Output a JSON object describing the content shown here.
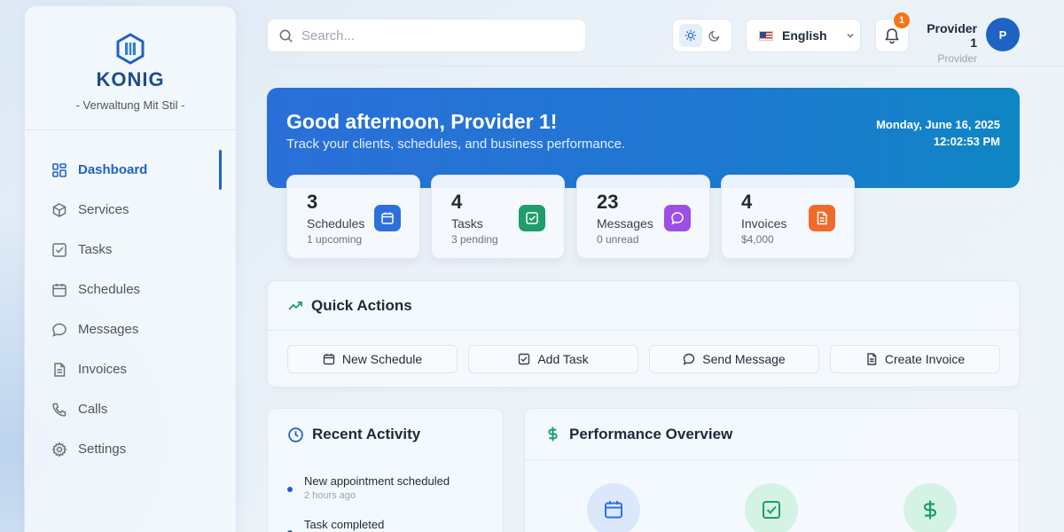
{
  "brand": {
    "name": "KONIG",
    "tagline": "- Verwaltung Mit Stil -"
  },
  "sidebar": {
    "items": [
      {
        "label": "Dashboard",
        "icon": "dashboard-icon",
        "active": true
      },
      {
        "label": "Services",
        "icon": "cube-icon"
      },
      {
        "label": "Tasks",
        "icon": "checkbox-icon"
      },
      {
        "label": "Schedules",
        "icon": "calendar-icon"
      },
      {
        "label": "Messages",
        "icon": "message-icon"
      },
      {
        "label": "Invoices",
        "icon": "document-icon"
      },
      {
        "label": "Calls",
        "icon": "phone-icon"
      },
      {
        "label": "Settings",
        "icon": "gear-icon"
      }
    ]
  },
  "topbar": {
    "search_placeholder": "Search...",
    "language": "English",
    "notifications_count": "1",
    "user_name": "Provider 1",
    "user_role": "Provider",
    "avatar_initial": "P"
  },
  "hero": {
    "greeting": "Good afternoon, Provider 1!",
    "subtitle": "Track your clients, schedules, and business performance.",
    "date": "Monday, June 16, 2025",
    "time": "12:02:53 PM"
  },
  "stats": [
    {
      "value": "3",
      "label": "Schedules",
      "sub": "1 upcoming",
      "icon": "calendar-icon",
      "color": "#2f6fdc"
    },
    {
      "value": "4",
      "label": "Tasks",
      "sub": "3 pending",
      "icon": "checkbox-icon",
      "color": "#1f9d6b"
    },
    {
      "value": "23",
      "label": "Messages",
      "sub": "0 unread",
      "icon": "message-icon",
      "color": "#9b4fe6"
    },
    {
      "value": "4",
      "label": "Invoices",
      "sub": "$4,000",
      "icon": "document-icon",
      "color": "#f06a2a"
    }
  ],
  "quick_actions": {
    "title": "Quick Actions",
    "buttons": [
      {
        "label": "New Schedule",
        "icon": "calendar-icon"
      },
      {
        "label": "Add Task",
        "icon": "checkbox-icon"
      },
      {
        "label": "Send Message",
        "icon": "message-icon"
      },
      {
        "label": "Create Invoice",
        "icon": "document-icon"
      }
    ]
  },
  "recent_activity": {
    "title": "Recent Activity",
    "items": [
      {
        "text": "New appointment scheduled",
        "time": "2 hours ago"
      },
      {
        "text": "Task completed",
        "time": ""
      }
    ]
  },
  "performance": {
    "title": "Performance Overview",
    "icons": [
      {
        "icon": "calendar-icon",
        "color": "#2f6fdc",
        "bg": "#dbe8fb"
      },
      {
        "icon": "checkbox-icon",
        "color": "#1f9d6b",
        "bg": "#d5f3e4"
      },
      {
        "icon": "dollar-icon",
        "color": "#1f9d6b",
        "bg": "#d5f3e4"
      }
    ]
  }
}
